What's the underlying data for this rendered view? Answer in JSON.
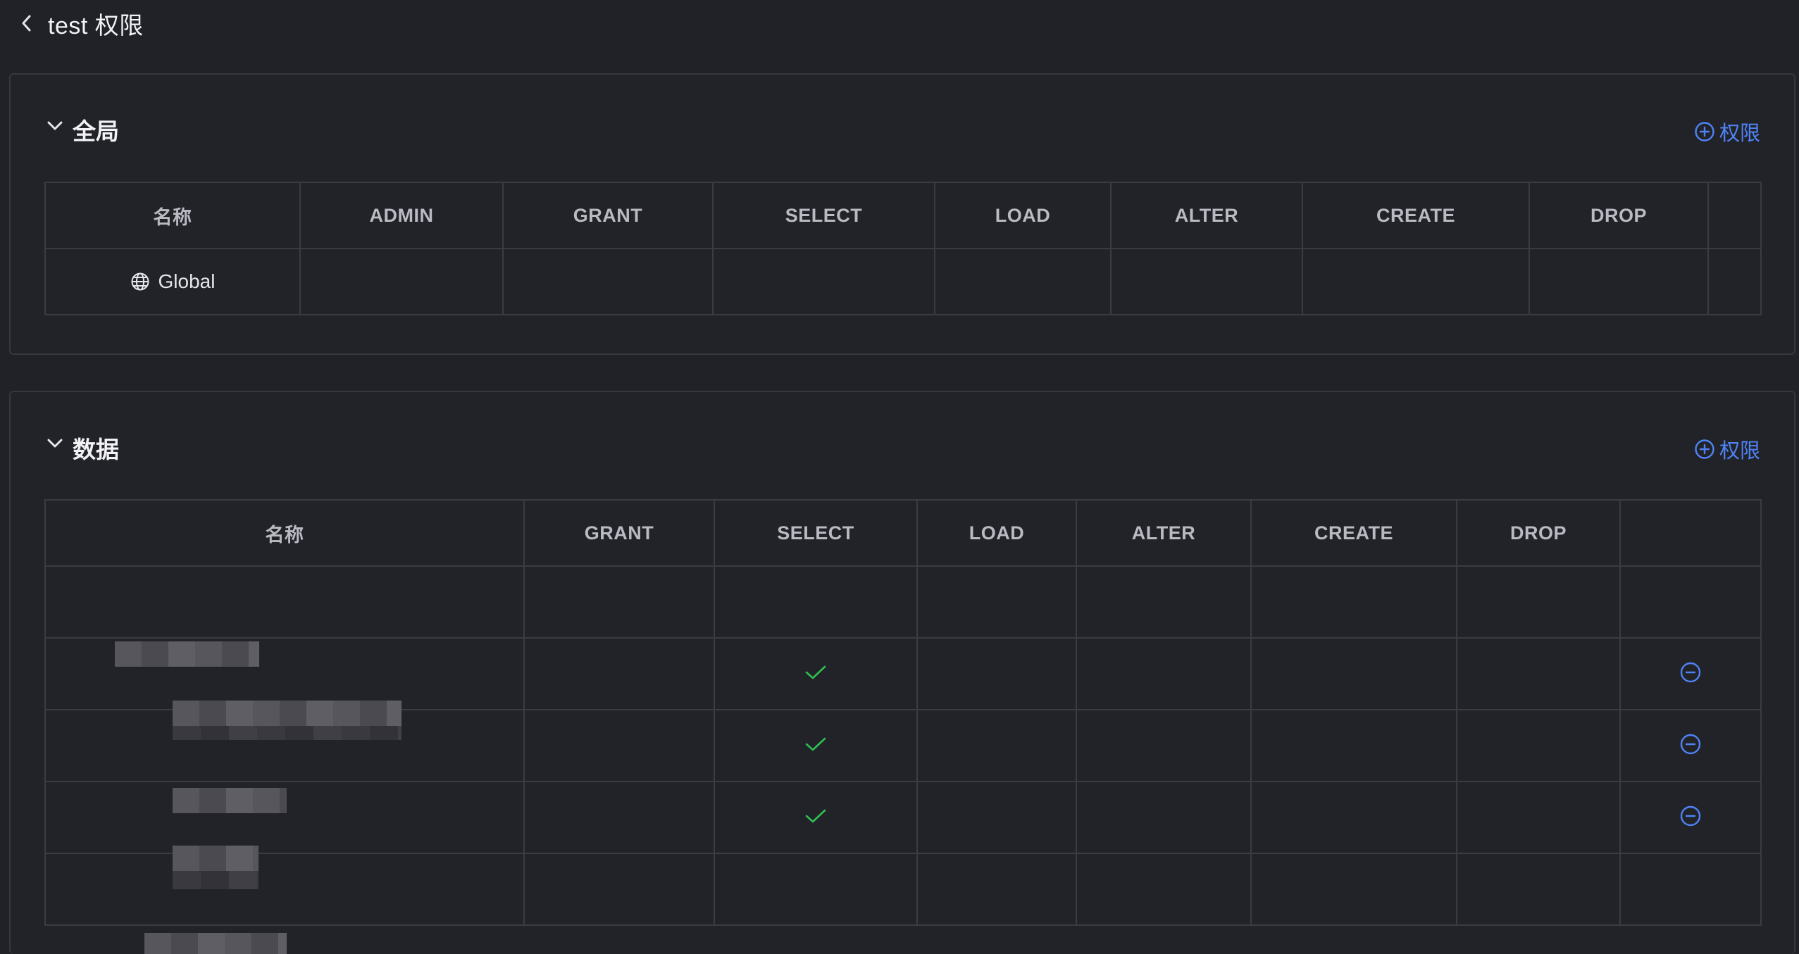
{
  "header": {
    "back_icon": "chevron-left-icon",
    "title": "test 权限"
  },
  "global_section": {
    "title": "全局",
    "add_label": "权限",
    "columns": [
      "名称",
      "ADMIN",
      "GRANT",
      "SELECT",
      "LOAD",
      "ALTER",
      "CREATE",
      "DROP",
      ""
    ],
    "rows": [
      {
        "icon": "globe-icon",
        "name": "Global",
        "checks": [
          false,
          false,
          false,
          false,
          false,
          false,
          false
        ]
      }
    ]
  },
  "data_section": {
    "title": "数据",
    "add_label": "权限",
    "columns": [
      "名称",
      "GRANT",
      "SELECT",
      "LOAD",
      "ALTER",
      "CREATE",
      "DROP",
      ""
    ],
    "rows": [
      {
        "name": "",
        "checks": [
          false,
          false,
          false,
          false,
          false,
          false
        ],
        "removable": false
      },
      {
        "name": "",
        "checks": [
          false,
          true,
          false,
          false,
          false,
          false
        ],
        "removable": true
      },
      {
        "name": "",
        "checks": [
          false,
          true,
          false,
          false,
          false,
          false
        ],
        "removable": true
      },
      {
        "name": "",
        "checks": [
          false,
          true,
          false,
          false,
          false,
          false
        ],
        "removable": true
      },
      {
        "name": "",
        "checks": [
          false,
          false,
          false,
          false,
          false,
          false
        ],
        "removable": false
      }
    ]
  },
  "colors": {
    "accent": "#4f83f5",
    "check": "#2fbf4f",
    "background": "#212228"
  }
}
